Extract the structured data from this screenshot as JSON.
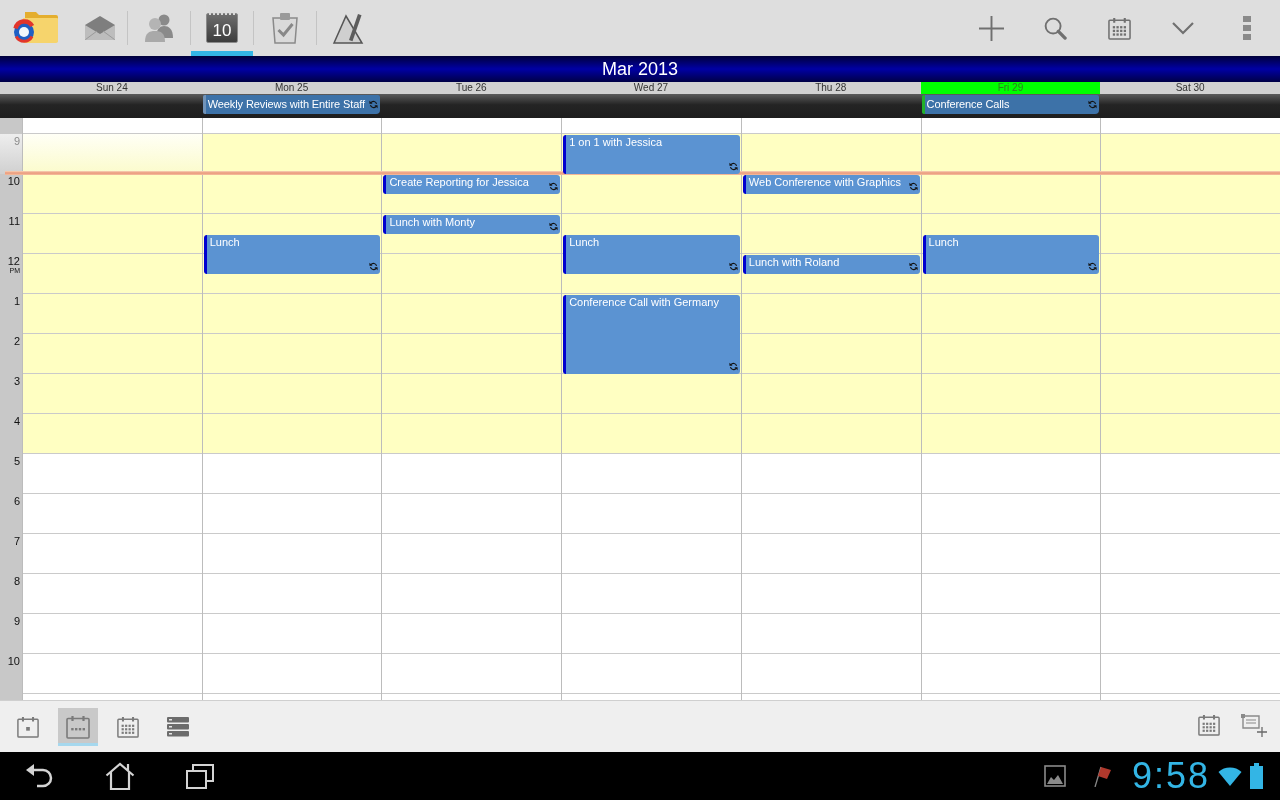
{
  "app_tabs": [
    {
      "kind": "folder",
      "selected": false
    },
    {
      "kind": "mail",
      "selected": false
    },
    {
      "kind": "contacts",
      "selected": false
    },
    {
      "kind": "calendar",
      "selected": true,
      "date": "10"
    },
    {
      "kind": "tasks",
      "selected": false
    },
    {
      "kind": "notes",
      "selected": false
    }
  ],
  "calendar": {
    "title": "Mar 2013",
    "days": [
      {
        "label": "Sun 24",
        "today": false
      },
      {
        "label": "Mon 25",
        "today": false,
        "all_day": [
          {
            "title": "Weekly Reviews with Entire Staff",
            "color": "#7193b8",
            "recurring": true
          }
        ]
      },
      {
        "label": "Tue 26",
        "today": false
      },
      {
        "label": "Wed 27",
        "today": false
      },
      {
        "label": "Thu 28",
        "today": false
      },
      {
        "label": "Fri 29",
        "today": true,
        "all_day": [
          {
            "title": "Conference Calls",
            "color": "#22b02a",
            "recurring": true
          }
        ]
      },
      {
        "label": "Sat 30",
        "today": false
      }
    ],
    "hours": [
      {
        "label": "9",
        "working": true,
        "now_line": {
          "level": 0.97
        },
        "cells": [
          {
            "selected": true
          },
          {
            "selected": false
          },
          {
            "selected": false
          },
          {
            "selected": false,
            "events": [
              {
                "title": "1 on 1 with Jessica",
                "kind": "hour",
                "half_past": false,
                "recurring": true
              }
            ]
          },
          {
            "selected": false
          },
          {
            "selected": false
          },
          {
            "selected": false
          }
        ]
      },
      {
        "label": "10",
        "working": true,
        "cells": [
          {
            "selected": false
          },
          {
            "selected": false
          },
          {
            "selected": false,
            "events": [
              {
                "title": "Create Reporting for Jessica",
                "kind": "half",
                "half_past": false,
                "recurring": true
              }
            ]
          },
          {
            "selected": false
          },
          {
            "selected": false,
            "events": [
              {
                "title": "Web Conference with Graphics",
                "kind": "half",
                "half_past": false,
                "recurring": true
              }
            ]
          },
          {
            "selected": false
          },
          {
            "selected": false
          }
        ]
      },
      {
        "label": "11",
        "working": true,
        "cells": [
          {
            "selected": false
          },
          {
            "selected": false,
            "events": [
              {
                "title": "Lunch",
                "kind": "hour",
                "half_past": true,
                "recurring": true
              }
            ]
          },
          {
            "selected": false,
            "events": [
              {
                "title": "Lunch with Monty",
                "kind": "half",
                "half_past": false,
                "recurring": true
              }
            ]
          },
          {
            "selected": false,
            "events": [
              {
                "title": "Lunch",
                "kind": "hour",
                "half_past": true,
                "recurring": true
              }
            ]
          },
          {
            "selected": false
          },
          {
            "selected": false,
            "events": [
              {
                "title": "Lunch",
                "kind": "hour",
                "half_past": true,
                "recurring": true
              }
            ]
          },
          {
            "selected": false
          }
        ]
      },
      {
        "label": "12",
        "suffix": "PM",
        "working": true,
        "cells": [
          {
            "selected": false
          },
          {
            "selected": false
          },
          {
            "selected": false
          },
          {
            "selected": false
          },
          {
            "selected": false,
            "events": [
              {
                "title": "Lunch with Roland",
                "kind": "half",
                "half_past": false,
                "recurring": true
              }
            ]
          },
          {
            "selected": false
          },
          {
            "selected": false
          }
        ]
      },
      {
        "label": "1",
        "working": true,
        "cells": [
          {
            "selected": false
          },
          {
            "selected": false
          },
          {
            "selected": false
          },
          {
            "selected": false,
            "events": [
              {
                "title": "Conference Call with Germany",
                "kind": "twohour",
                "half_past": false,
                "recurring": true
              }
            ]
          },
          {
            "selected": false
          },
          {
            "selected": false
          },
          {
            "selected": false
          }
        ]
      },
      {
        "label": "2",
        "working": true,
        "cells": [
          {
            "selected": false
          },
          {
            "selected": false
          },
          {
            "selected": false
          },
          {
            "selected": false
          },
          {
            "selected": false
          },
          {
            "selected": false
          },
          {
            "selected": false
          }
        ]
      },
      {
        "label": "3",
        "working": true,
        "cells": [
          {
            "selected": false
          },
          {
            "selected": false
          },
          {
            "selected": false
          },
          {
            "selected": false
          },
          {
            "selected": false
          },
          {
            "selected": false
          },
          {
            "selected": false
          }
        ]
      },
      {
        "label": "4",
        "working": true,
        "cells": [
          {
            "selected": false
          },
          {
            "selected": false
          },
          {
            "selected": false
          },
          {
            "selected": false
          },
          {
            "selected": false
          },
          {
            "selected": false
          },
          {
            "selected": false
          }
        ]
      },
      {
        "label": "5",
        "working": false,
        "cells": [
          {
            "selected": false
          },
          {
            "selected": false
          },
          {
            "selected": false
          },
          {
            "selected": false
          },
          {
            "selected": false
          },
          {
            "selected": false
          },
          {
            "selected": false
          }
        ]
      },
      {
        "label": "6",
        "working": false,
        "cells": [
          {
            "selected": false
          },
          {
            "selected": false
          },
          {
            "selected": false
          },
          {
            "selected": false
          },
          {
            "selected": false
          },
          {
            "selected": false
          },
          {
            "selected": false
          }
        ]
      },
      {
        "label": "7",
        "working": false,
        "cells": [
          {
            "selected": false
          },
          {
            "selected": false
          },
          {
            "selected": false
          },
          {
            "selected": false
          },
          {
            "selected": false
          },
          {
            "selected": false
          },
          {
            "selected": false
          }
        ]
      },
      {
        "label": "8",
        "working": false,
        "cells": [
          {
            "selected": false
          },
          {
            "selected": false
          },
          {
            "selected": false
          },
          {
            "selected": false
          },
          {
            "selected": false
          },
          {
            "selected": false
          },
          {
            "selected": false
          }
        ]
      },
      {
        "label": "9",
        "working": false,
        "cells": [
          {
            "selected": false
          },
          {
            "selected": false
          },
          {
            "selected": false
          },
          {
            "selected": false
          },
          {
            "selected": false
          },
          {
            "selected": false
          },
          {
            "selected": false
          }
        ]
      },
      {
        "label": "10",
        "working": false,
        "cells": [
          {
            "selected": false
          },
          {
            "selected": false
          },
          {
            "selected": false
          },
          {
            "selected": false
          },
          {
            "selected": false
          },
          {
            "selected": false
          },
          {
            "selected": false
          }
        ]
      }
    ]
  },
  "view_modes": [
    {
      "kind": "day",
      "selected": false
    },
    {
      "kind": "week",
      "selected": true
    },
    {
      "kind": "month",
      "selected": false
    },
    {
      "kind": "agenda",
      "selected": false
    }
  ],
  "status_bar": {
    "time": "9:58"
  }
}
